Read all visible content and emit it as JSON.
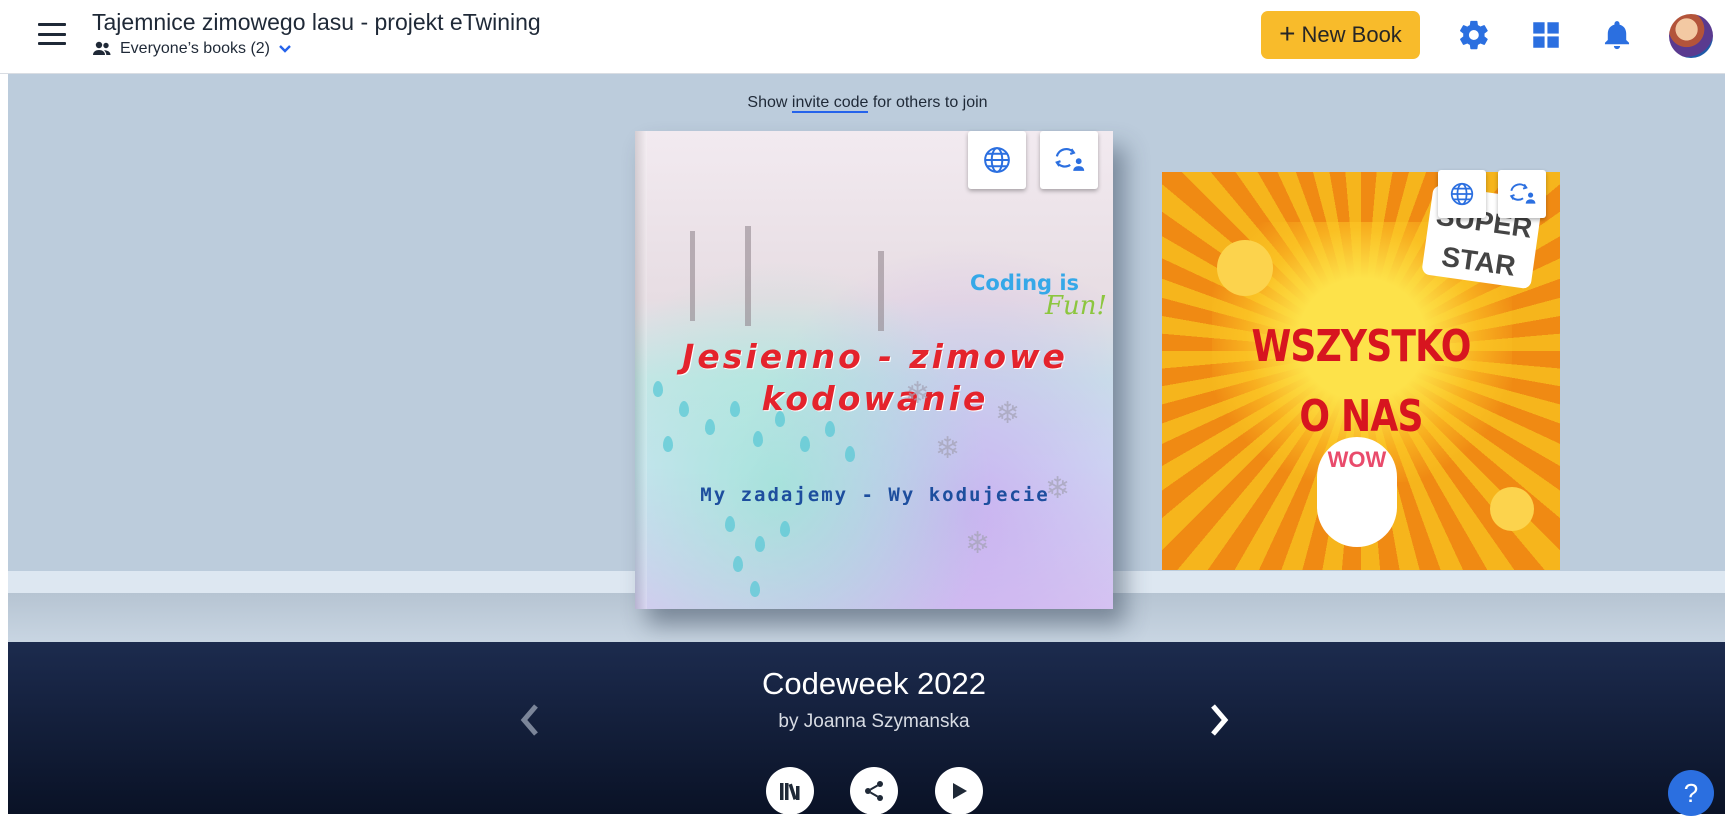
{
  "header": {
    "title": "Tajemnice zimowego lasu - projekt eTwining",
    "books_filter": "Everyone’s books (2)",
    "new_book_label": "New Book",
    "icons": [
      "menu-icon",
      "people-icon",
      "chevron-down-icon",
      "plus-icon",
      "gear-icon",
      "dashboard-icon",
      "bell-icon"
    ]
  },
  "invite": {
    "prefix": "Show",
    "link": "invite code",
    "suffix": "for others to join"
  },
  "books": [
    {
      "cover_coding": "Coding is",
      "cover_fun": "Fun!",
      "cover_title": "Jesienno - zimowe kodowanie",
      "cover_subtitle": "My zadajemy - Wy kodujecie"
    },
    {
      "cover_title_line1": "WSZYSTKO",
      "cover_title_line2": "O NAS",
      "sticker_text": "SUPER STAR",
      "wow_text": "WOW"
    }
  ],
  "selected_book": {
    "title": "Codeweek 2022",
    "author": "by Joanna Szymanska"
  },
  "controls": {
    "prev": "‹",
    "next": "›",
    "help": "?"
  },
  "colors": {
    "accent": "#2563eb",
    "new_book_bg": "#f8bb2b",
    "stage_bg": "#bcccdc",
    "bottom_bg": "#1c2b4e"
  }
}
